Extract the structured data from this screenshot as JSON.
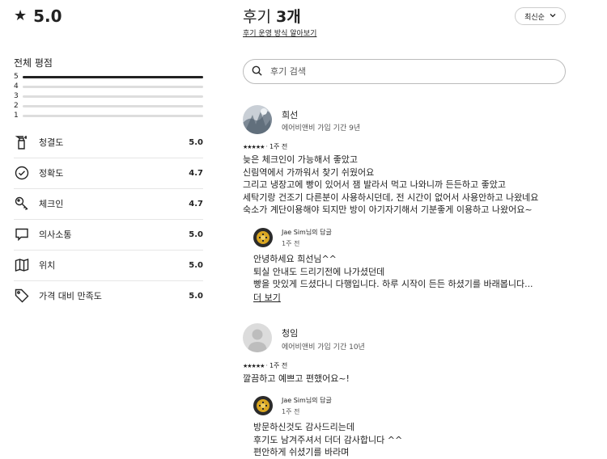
{
  "summary": {
    "rating": "5.0",
    "overall_label": "전체 평점",
    "distribution": [
      {
        "label": "5",
        "fraction": 1.0
      },
      {
        "label": "4",
        "fraction": 0.0
      },
      {
        "label": "3",
        "fraction": 0.0
      },
      {
        "label": "2",
        "fraction": 0.0
      },
      {
        "label": "1",
        "fraction": 0.0
      }
    ],
    "categories": [
      {
        "label": "청결도",
        "score": "5.0",
        "icon": "spray-bottle-icon"
      },
      {
        "label": "정확도",
        "score": "4.7",
        "icon": "check-circle-icon"
      },
      {
        "label": "체크인",
        "score": "4.7",
        "icon": "key-icon"
      },
      {
        "label": "의사소통",
        "score": "5.0",
        "icon": "chat-bubble-icon"
      },
      {
        "label": "위치",
        "score": "5.0",
        "icon": "map-icon"
      },
      {
        "label": "가격 대비 만족도",
        "score": "5.0",
        "icon": "tag-icon"
      }
    ]
  },
  "reviews_header": {
    "title_prefix": "후기",
    "title_count": "3개",
    "policy_link": "후기 운영 방식 알아보기",
    "sort_label": "최신순",
    "search_placeholder": "후기 검색"
  },
  "reviews": [
    {
      "name": "희선",
      "tenure": "에어비앤비 가입 기간 9년",
      "stars": "★★★★★",
      "time": "1주 전",
      "body": "늦은 체크인이 가능해서 좋았고\n신림역에서 가까워서 찾기 쉬웠어요\n그리고 냉장고에 빵이 있어서 잼 발라서 먹고 나와니까 든든하고 좋았고\n세탁기랑 건조기 다른분이 사용하시던데, 전 시간이 없어서 사용안하고 나왔네요\n숙소가 계단이용해야 되지만 방이 아기자기해서 기분좋게 이용하고 나왔어요~",
      "reply": {
        "name": "Jae Sim님의 답글",
        "time": "1주 전",
        "body": "안녕하세요 희선님^^\n퇴실 안내도 드리기전에 나가셨던데\n빵을 맛있게 드셨다니 다행입니다. 하루 시작이 든든 하셨기를 바래봅니다...",
        "more": "더 보기"
      }
    },
    {
      "name": "청임",
      "tenure": "에어비앤비 가입 기간 10년",
      "stars": "★★★★★",
      "time": "1주 전",
      "body": "깔끔하고 예쁘고 편했어요~!",
      "reply": {
        "name": "Jae Sim님의 답글",
        "time": "1주 전",
        "body": "방문하신것도 감사드리는데\n후기도 남겨주셔서 더더 감사합니다 ^^\n편안하게 쉬셨기를 바라며"
      }
    }
  ]
}
